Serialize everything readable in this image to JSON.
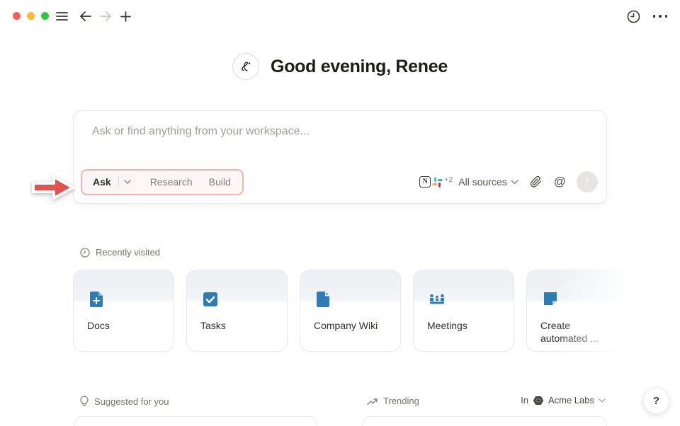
{
  "window": {
    "controls": [
      "close",
      "minimize",
      "zoom"
    ]
  },
  "topbar": {
    "left_icons": [
      "menu-icon",
      "back-arrow-icon",
      "forward-arrow-icon",
      "plus-icon"
    ],
    "right_icons": [
      "history-clock-icon",
      "more-ellipsis-icon"
    ]
  },
  "greeting": {
    "title": "Good evening, Renee",
    "avatar_icon": "notion-ai-face-icon"
  },
  "composer": {
    "placeholder": "Ask or find anything from your workspace...",
    "modes": {
      "ask": "Ask",
      "research": "Research",
      "build": "Build"
    },
    "sources": {
      "notion_badge": "N",
      "extra_count": "+2",
      "label": "All sources",
      "icons": [
        "notion-icon",
        "slack-icon"
      ]
    },
    "mention_glyph": "@",
    "send_glyph": "↑"
  },
  "annotation": {
    "type": "red-arrow-and-box",
    "color": "#e4524f",
    "target": "mode-switcher"
  },
  "recently_visited": {
    "label": "Recently visited",
    "cards": [
      {
        "title": "Docs",
        "icon": "doc-plus-icon"
      },
      {
        "title": "Tasks",
        "icon": "checkbox-icon"
      },
      {
        "title": "Company Wiki",
        "icon": "page-icon"
      },
      {
        "title": "Meetings",
        "icon": "meeting-people-icon"
      },
      {
        "title": "Create automated ...",
        "icon": "note-fold-icon"
      }
    ]
  },
  "sections": {
    "suggested": {
      "label": "Suggested for you",
      "icon": "lightbulb-icon"
    },
    "trending": {
      "label": "Trending",
      "icon": "trending-up-icon"
    },
    "workspace": {
      "prefix": "In",
      "name": "Acme Labs",
      "icon": "workspace-logo-icon"
    }
  },
  "help": {
    "label": "?"
  },
  "colors": {
    "accent_blue": "#2e7cb5",
    "annotation_red": "#e4524f",
    "card_header": "#edf0f4",
    "traffic": [
      "#f65f57",
      "#fbbe2e",
      "#2bc840"
    ],
    "slack": [
      "#36C5F0",
      "#2EB67D",
      "#E01E5A",
      "#ECB22E"
    ]
  }
}
